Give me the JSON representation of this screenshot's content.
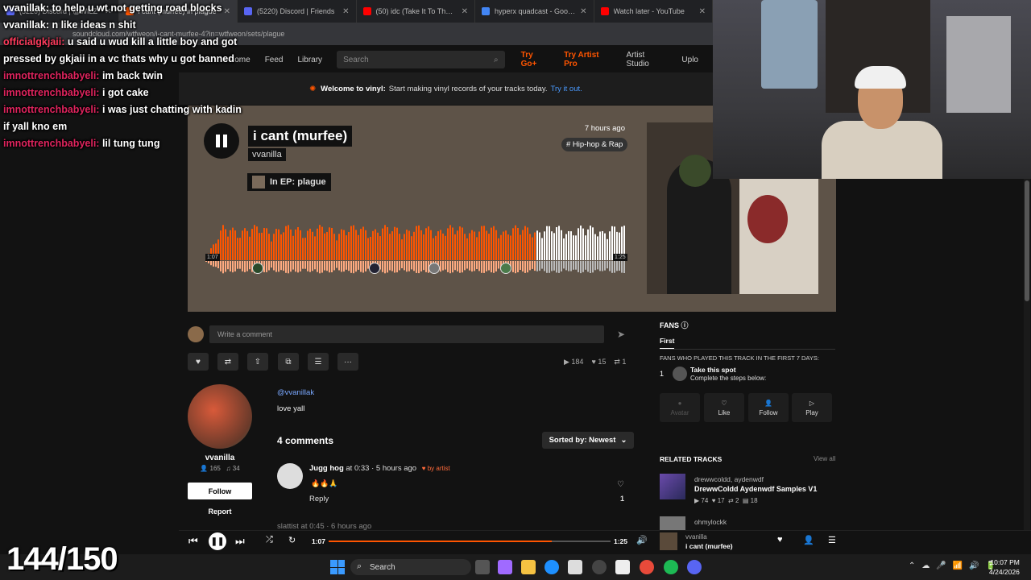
{
  "browser": {
    "tabs": [
      {
        "title": "(5220) Discord | @WILZ",
        "color": "#5865f2",
        "active": false
      },
      {
        "title": "i cant (murfee) in plague",
        "color": "#ff5500",
        "active": true
      },
      {
        "title": "(5220) Discord | Friends",
        "color": "#5865f2",
        "active": false
      },
      {
        "title": "(50) idc (Take It To The Worl",
        "color": "#ff0000",
        "active": false
      },
      {
        "title": "hyperx quadcast - Google S",
        "color": "#4285f4",
        "active": false
      },
      {
        "title": "Watch later - YouTube",
        "color": "#ff0000",
        "active": false
      }
    ],
    "url": "soundcloud.com/wtfweon/i-cant-murfee-4?in=wtfweon/sets/plague"
  },
  "header": {
    "nav": [
      "Home",
      "Feed",
      "Library"
    ],
    "search_placeholder": "Search",
    "try_go": "Try Go+",
    "try_artist": "Try Artist Pro",
    "artist_studio": "Artist Studio",
    "upload": "Uplo"
  },
  "banner": {
    "bold": "Welcome to vinyl:",
    "text": "Start making vinyl records of your tracks today.",
    "link": "Try it out."
  },
  "track": {
    "title": "i cant (murfee)",
    "artist": "vvanilla",
    "ep": "In EP: plague",
    "ago": "7 hours ago",
    "tag": "# Hip-hop & Rap",
    "time_current": "1:07",
    "time_total": "1:25",
    "progress": 0.79
  },
  "comment_bar": {
    "placeholder": "Write a comment"
  },
  "stats": {
    "plays": "184",
    "likes": "15",
    "reposts": "1"
  },
  "artist_card": {
    "name": "vvanilla",
    "followers": "165",
    "tracks": "34",
    "follow": "Follow",
    "report": "Report",
    "handle": "@vvanillak",
    "description": "love yall"
  },
  "comments": {
    "count_label": "4 comments",
    "sort_label": "Sorted by: Newest",
    "items": [
      {
        "user": "Jugg hog",
        "at": "at",
        "time": "0:33",
        "ago": "· 5 hours ago",
        "by": "by artist",
        "text": "🔥🔥🙏",
        "reply": "Reply",
        "likes": "1"
      }
    ],
    "next_preview": "slattist at 0:45 · 6 hours ago"
  },
  "fans": {
    "heading": "FANS",
    "tab": "First",
    "subheading": "FANS WHO PLAYED THIS TRACK IN THE FIRST 7 DAYS:",
    "rank": "1",
    "spot_title": "Take this spot",
    "spot_sub": "Complete the steps below:",
    "buttons": [
      "Avatar",
      "Like",
      "Follow",
      "Play"
    ]
  },
  "related": {
    "heading": "RELATED TRACKS",
    "view_all": "View all",
    "items": [
      {
        "artist": "drewwcoldd, aydenwdf",
        "title": "DrewwColdd Aydenwdf Samples V1",
        "plays": "74",
        "likes": "17",
        "reposts": "2",
        "comments": "18"
      },
      {
        "artist": "ohmylockk",
        "title": "",
        "plays": "",
        "likes": "",
        "reposts": "",
        "comments": ""
      }
    ]
  },
  "player": {
    "current": "1:07",
    "total": "1:25",
    "progress": 0.79,
    "artist": "vvanilla",
    "title": "i cant (murfee)"
  },
  "taskbar": {
    "search": "Search",
    "time": "10:07 PM",
    "date": "4/24/2026"
  },
  "chat": [
    {
      "user": "vvanillak:",
      "msg": "to help u wt not getting road blocks",
      "cls": "u1"
    },
    {
      "user": "vvanillak:",
      "msg": "n like ideas n shit",
      "cls": "u1"
    },
    {
      "user": "officialgkjaii:",
      "msg": "u said u wud kill a little boy and got pressed by gkjaii in a vc thats why u got banned",
      "cls": "u2"
    },
    {
      "user": "imnottrenchbabyeli:",
      "msg": "im back twin",
      "cls": "u3"
    },
    {
      "user": "imnottrenchbabyeli:",
      "msg": "i got cake",
      "cls": "u3"
    },
    {
      "user": "imnottrenchbabyeli:",
      "msg": "i was just chatting with kadin if yall kno em",
      "cls": "u3"
    },
    {
      "user": "imnottrenchbabyeli:",
      "msg": "lil tung tung",
      "cls": "u3"
    }
  ],
  "counter": "144/150"
}
